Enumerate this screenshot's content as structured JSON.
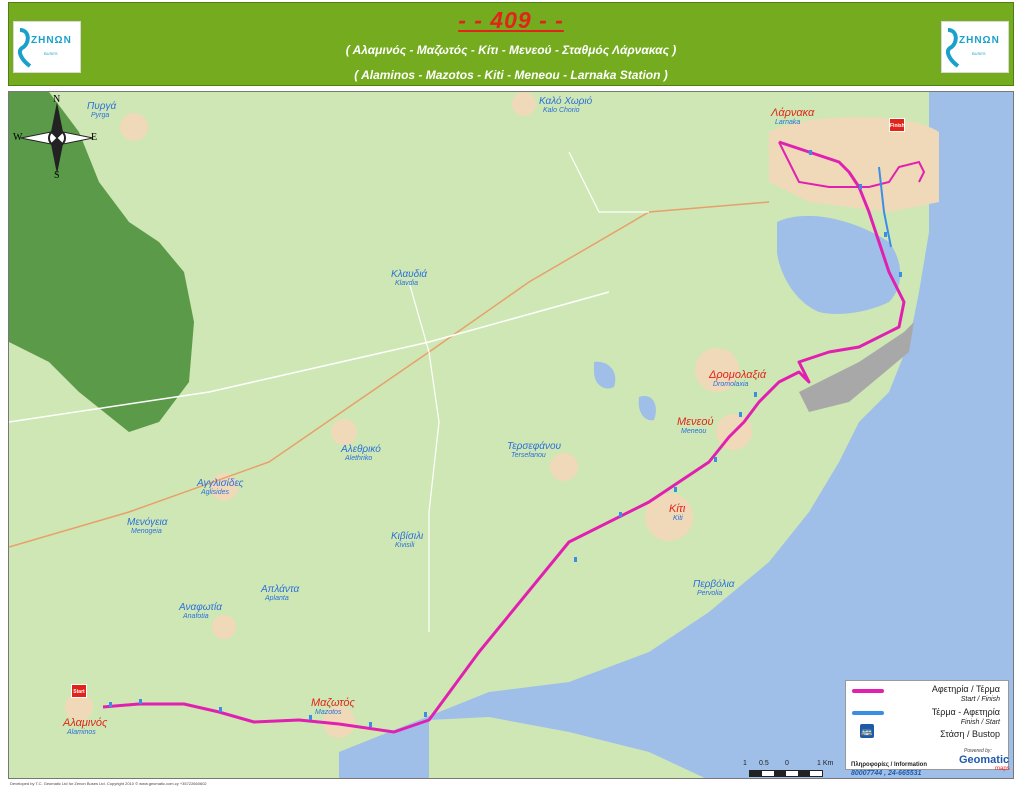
{
  "header": {
    "route_number": "- -  409  - -",
    "greek_route": "( Αλαμινός - Μαζωτός - Κίτι - Μενεού - Σταθμός Λάρνακας )",
    "latin_route": "( Alaminos - Mazotos - Kiti - Meneou - Larnaka Station )",
    "brand": "ZHNΩN",
    "brand_sub": "BUSES"
  },
  "compass": {
    "n": "N",
    "e": "E",
    "s": "S",
    "w": "W"
  },
  "places": [
    {
      "gr": "Πυργά",
      "lt": "Pyrga",
      "red": false
    },
    {
      "gr": "Καλό Χωριό",
      "lt": "Kalo Chorio",
      "red": false
    },
    {
      "gr": "Λάρνακα",
      "lt": "Larnaka",
      "red": true
    },
    {
      "gr": "Κλαυδιά",
      "lt": "Klavdia",
      "red": false
    },
    {
      "gr": "Δρομολαξιά",
      "lt": "Dromolaxia",
      "red": true
    },
    {
      "gr": "Μενεού",
      "lt": "Meneou",
      "red": true
    },
    {
      "gr": "Αλεθρικό",
      "lt": "Alethriko",
      "red": false
    },
    {
      "gr": "Τερσεφάνου",
      "lt": "Tersefanou",
      "red": false
    },
    {
      "gr": "Αγγλισίδες",
      "lt": "Aglisides",
      "red": false
    },
    {
      "gr": "Κίτι",
      "lt": "Kiti",
      "red": true
    },
    {
      "gr": "Μενόγεια",
      "lt": "Menogeia",
      "red": false
    },
    {
      "gr": "Κιβίσιλι",
      "lt": "Kivisili",
      "red": false
    },
    {
      "gr": "Απλάντα",
      "lt": "Aplanta",
      "red": false
    },
    {
      "gr": "Αναφωτία",
      "lt": "Anafotia",
      "red": false
    },
    {
      "gr": "Περβόλια",
      "lt": "Pervolia",
      "red": false
    },
    {
      "gr": "Μαζωτός",
      "lt": "Mazotos",
      "red": true
    },
    {
      "gr": "Αλαμινός",
      "lt": "Alaminos",
      "red": true
    }
  ],
  "terminals": {
    "start": "Start",
    "finish": "Finish"
  },
  "legend": {
    "start_finish_gr": "Αφετηρία / Τέρμα",
    "start_finish_en": "Start / Finish",
    "finish_start_gr": "Τέρμα - Αφετηρία",
    "finish_start_en": "Finish / Start",
    "bustop": "Στάση / Bustop",
    "route_color": "#e020b0",
    "return_color": "#3a8ee6"
  },
  "scale": {
    "t0": "1",
    "t1": "0.5",
    "t2": "0",
    "t3": "1 Km"
  },
  "info": {
    "label": "Πληροφορίες / Information",
    "phones": "80007744 , 24-665531",
    "powered": "Powered by:",
    "company": "Geomatic",
    "company_sub": "maps"
  },
  "footer": "Developed by T.C. Geomatic Ltd for Zenon Buses Ltd.   Copyright 2010 ©  www.geomatic.com.cy  +35722660602",
  "colors": {
    "header_green": "#74ab1f",
    "land": "#cfe7b4",
    "forest": "#5a9a48",
    "sea": "#9fbfe8",
    "urban": "#f0d9b8"
  }
}
